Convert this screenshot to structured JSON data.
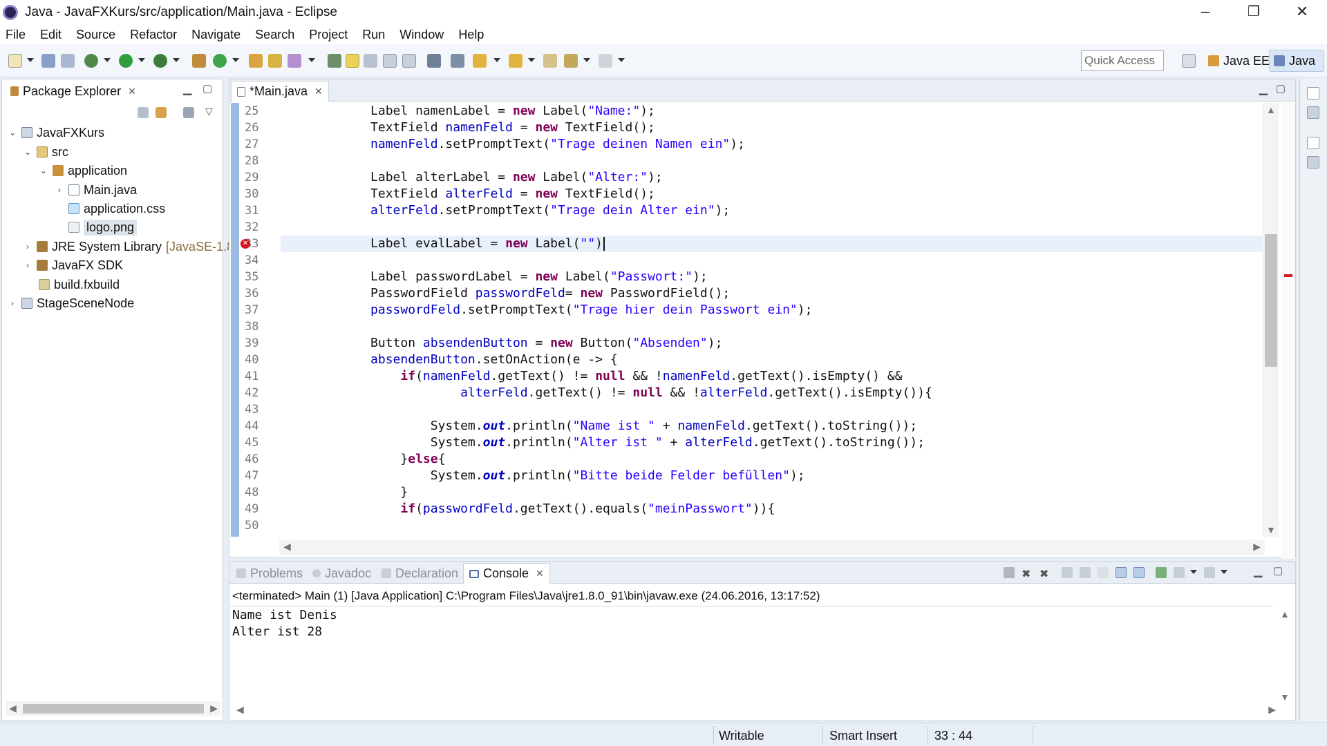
{
  "window": {
    "title": "Java - JavaFXKurs/src/application/Main.java - Eclipse",
    "controls": {
      "minimize": "–",
      "maximize": "❐",
      "close": "✕"
    }
  },
  "menu": [
    "File",
    "Edit",
    "Source",
    "Refactor",
    "Navigate",
    "Search",
    "Project",
    "Run",
    "Window",
    "Help"
  ],
  "toolbar": {
    "quick_access_placeholder": "Quick Access",
    "perspective_javaee": "Java EE",
    "perspective_java": "Java"
  },
  "package_explorer": {
    "tab_label": "Package Explorer",
    "tree": [
      {
        "label": "JavaFXKurs",
        "depth": 0,
        "expanded": true,
        "icon": "project-icon"
      },
      {
        "label": "src",
        "depth": 1,
        "expanded": true,
        "icon": "source-folder-icon"
      },
      {
        "label": "application",
        "depth": 2,
        "expanded": true,
        "icon": "package-icon"
      },
      {
        "label": "Main.java",
        "depth": 3,
        "expanded": false,
        "icon": "java-file-icon"
      },
      {
        "label": "application.css",
        "depth": 3,
        "icon": "css-file-icon"
      },
      {
        "label": "logo.png",
        "depth": 3,
        "icon": "image-file-icon",
        "selected": true
      },
      {
        "label": "JRE System Library",
        "suffix": "[JavaSE-1.8",
        "depth": 1,
        "expanded": false,
        "icon": "library-icon"
      },
      {
        "label": "JavaFX SDK",
        "depth": 1,
        "expanded": false,
        "icon": "library-icon"
      },
      {
        "label": "build.fxbuild",
        "depth": 1,
        "icon": "fxbuild-file-icon"
      },
      {
        "label": "StageSceneNode",
        "depth": 0,
        "expanded": false,
        "icon": "project-icon"
      }
    ]
  },
  "editor": {
    "tab_label": "*Main.java",
    "current_line": 33,
    "error_line": 33,
    "line_numbers": [
      "25",
      "26",
      "27",
      "28",
      "29",
      "30",
      "31",
      "32",
      "33",
      "34",
      "35",
      "36",
      "37",
      "38",
      "39",
      "40",
      "41",
      "42",
      "43",
      "44",
      "45",
      "46",
      "47",
      "48",
      "49",
      "50"
    ],
    "lines": [
      "            Label namenLabel = new Label(\"Name:\");",
      "            TextField namenFeld = new TextField();",
      "            namenFeld.setPromptText(\"Trage deinen Namen ein\");",
      "",
      "            Label alterLabel = new Label(\"Alter:\");",
      "            TextField alterFeld = new TextField();",
      "            alterFeld.setPromptText(\"Trage dein Alter ein\");",
      "",
      "            Label evalLabel = new Label(\"\")",
      "",
      "            Label passwordLabel = new Label(\"Passwort:\");",
      "            PasswordField passwordFeld= new PasswordField();",
      "            passwordFeld.setPromptText(\"Trage hier dein Passwort ein\");",
      "",
      "            Button absendenButton = new Button(\"Absenden\");",
      "            absendenButton.setOnAction(e -> {",
      "                if(namenFeld.getText() != null && !namenFeld.getText().isEmpty() &&",
      "                        alterFeld.getText() != null && !alterFeld.getText().isEmpty()){",
      "",
      "                    System.out.println(\"Name ist \" + namenFeld.getText().toString());",
      "                    System.out.println(\"Alter ist \" + alterFeld.getText().toString());",
      "                }else{",
      "                    System.out.println(\"Bitte beide Felder befüllen\");",
      "                }",
      "                if(passwordFeld.getText().equals(\"meinPasswort\")){",
      ""
    ]
  },
  "bottom_panel": {
    "tabs": [
      {
        "label": "Problems",
        "active": false
      },
      {
        "label": "Javadoc",
        "active": false
      },
      {
        "label": "Declaration",
        "active": false
      },
      {
        "label": "Console",
        "active": true
      }
    ],
    "console_header": "<terminated> Main (1) [Java Application] C:\\Program Files\\Java\\jre1.8.0_91\\bin\\javaw.exe (24.06.2016, 13:17:52)",
    "console_output": "Name ist Denis\nAlter ist 28"
  },
  "status": {
    "mode": "Writable",
    "insert": "Smart Insert",
    "position": "33 : 44"
  },
  "colors": {
    "keyword": "#7f0055",
    "string": "#2a00ff",
    "field": "#0000c0",
    "gutter": "#9cbbe3",
    "error": "#d6161f"
  }
}
